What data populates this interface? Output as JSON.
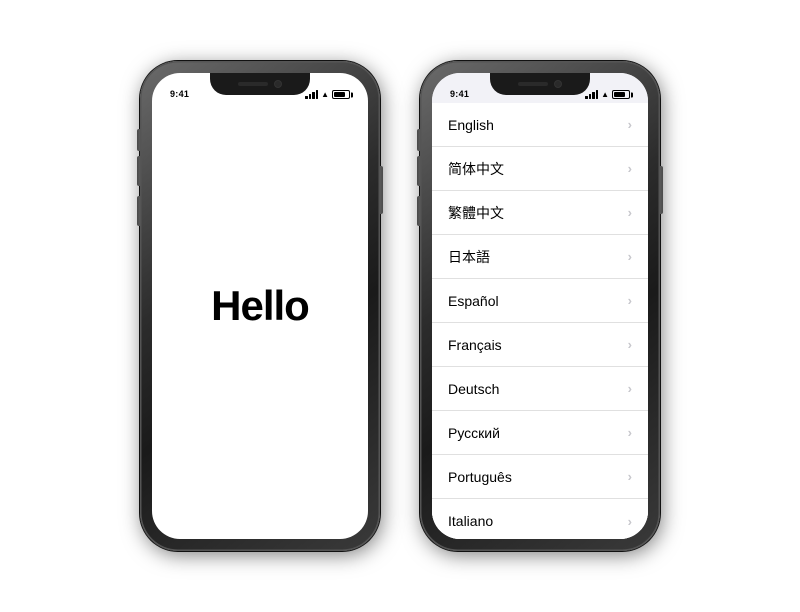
{
  "page": {
    "background": "#ffffff"
  },
  "phone1": {
    "status": {
      "time": "9:41",
      "signal_label": "signal",
      "wifi_label": "wifi",
      "battery_label": "battery"
    },
    "screen": {
      "hello_text": "Hello"
    }
  },
  "phone2": {
    "status": {
      "time": "9:41"
    },
    "languages": [
      {
        "id": "english",
        "name": "English"
      },
      {
        "id": "simplified-chinese",
        "name": "简体中文"
      },
      {
        "id": "traditional-chinese",
        "name": "繁體中文"
      },
      {
        "id": "japanese",
        "name": "日本語"
      },
      {
        "id": "spanish",
        "name": "Español"
      },
      {
        "id": "french",
        "name": "Français"
      },
      {
        "id": "german",
        "name": "Deutsch"
      },
      {
        "id": "russian",
        "name": "Русский"
      },
      {
        "id": "portuguese",
        "name": "Português"
      },
      {
        "id": "italian",
        "name": "Italiano"
      }
    ]
  }
}
